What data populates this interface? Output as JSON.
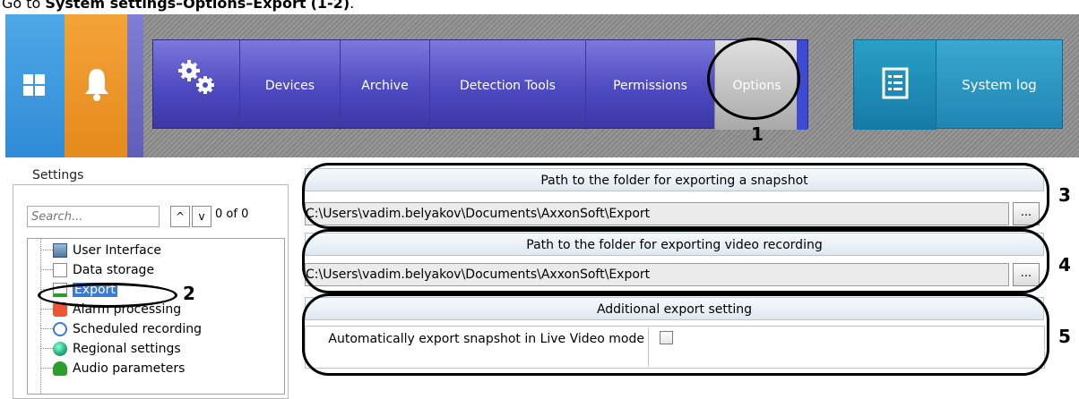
{
  "caption": {
    "prefix": "Go to ",
    "path": "System settings–Options–Export",
    "steps": "(1-2)",
    "suffix": "."
  },
  "topbar": {
    "menu_items": [
      {
        "label": "Devices"
      },
      {
        "label": "Archive"
      },
      {
        "label": "Detection Tools"
      },
      {
        "label": "Permissions"
      },
      {
        "label": "Options"
      }
    ],
    "system_log_label": "System log",
    "colors": {
      "windows": "#3a9be0",
      "bell": "#ee9628",
      "menu": "#4e4ac0",
      "log": "#1f86b3"
    }
  },
  "settings": {
    "title": "Settings",
    "search_placeholder": "Search...",
    "counter": "0 of 0",
    "tree": [
      {
        "label": "User Interface",
        "icon": "monitor-icon"
      },
      {
        "label": "Data storage",
        "icon": "data-storage-icon"
      },
      {
        "label": "Export",
        "icon": "export-icon",
        "selected": true
      },
      {
        "label": "Alarm processing",
        "icon": "alarm-icon"
      },
      {
        "label": "Scheduled recording",
        "icon": "schedule-icon"
      },
      {
        "label": "Regional settings",
        "icon": "globe-icon"
      },
      {
        "label": "Audio parameters",
        "icon": "audio-icon"
      }
    ]
  },
  "export": {
    "snapshot_header": "Path to the folder for exporting a snapshot",
    "snapshot_path": "C:\\Users\\vadim.belyakov\\Documents\\AxxonSoft\\Export",
    "video_header": "Path to the folder for exporting video recording",
    "video_path": "C:\\Users\\vadim.belyakov\\Documents\\AxxonSoft\\Export",
    "additional_header": "Additional export setting",
    "auto_export_label": "Automatically export snapshot in Live Video mode",
    "auto_export_checked": false,
    "browse_label": "..."
  },
  "annotations": [
    "1",
    "2",
    "3",
    "4",
    "5"
  ]
}
